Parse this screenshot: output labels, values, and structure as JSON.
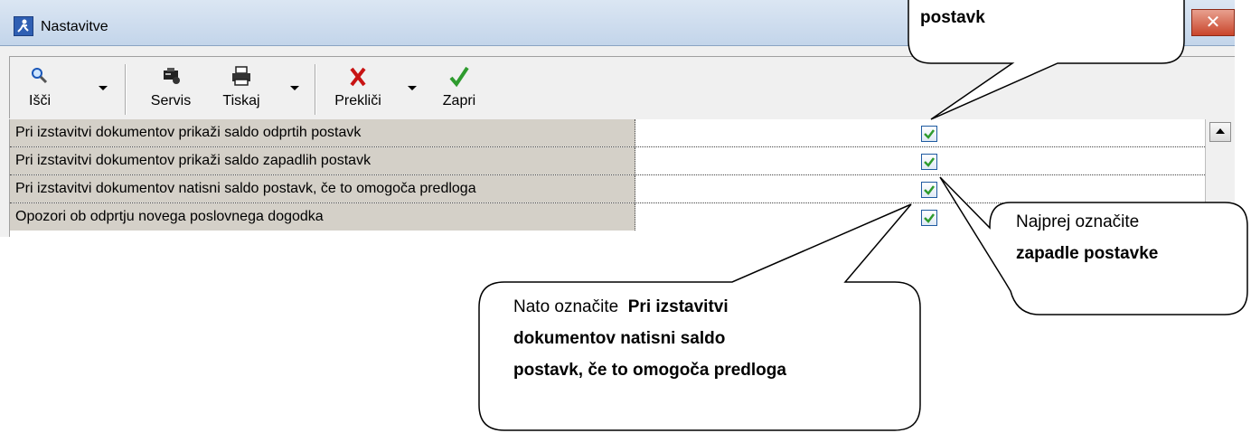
{
  "window": {
    "title": "Nastavitve",
    "close_glyph": "✕"
  },
  "toolbar": {
    "buttons": [
      {
        "label": "Išči",
        "icon": "magnifier-icon"
      },
      {
        "label": "Servis",
        "icon": "servis-icon"
      },
      {
        "label": "Tiskaj",
        "icon": "printer-icon"
      },
      {
        "label": "Prekliči",
        "icon": "red-x-icon"
      },
      {
        "label": "Zapri",
        "icon": "green-check-icon"
      }
    ]
  },
  "grid": {
    "rows": [
      {
        "label": "Pri izstavitvi dokumentov prikaži saldo odprtih postavk",
        "checked": true
      },
      {
        "label": "Pri izstavitvi dokumentov prikaži saldo zapadlih postavk",
        "checked": true
      },
      {
        "label": "Pri izstavitvi dokumentov natisni saldo postavk, če to omogoča predloga",
        "checked": true
      },
      {
        "label": "Opozori ob odprtju novega poslovnega dogodka",
        "checked": true
      }
    ]
  },
  "callouts": {
    "top": {
      "bold": "postavk"
    },
    "right": {
      "line1": "Najprej označite",
      "bold": "zapadle postavke"
    },
    "bottom": {
      "line1_plain": "Nato označite",
      "line1_bold": "Pri izstavitvi",
      "line2_bold": "dokumentov natisni saldo",
      "line3_bold": "postavk, če to omogoča predloga"
    }
  },
  "colors": {
    "accent_check": "#2e9b2e",
    "cancel_red": "#c81414",
    "label_cell_bg": "#d4d0c8"
  }
}
